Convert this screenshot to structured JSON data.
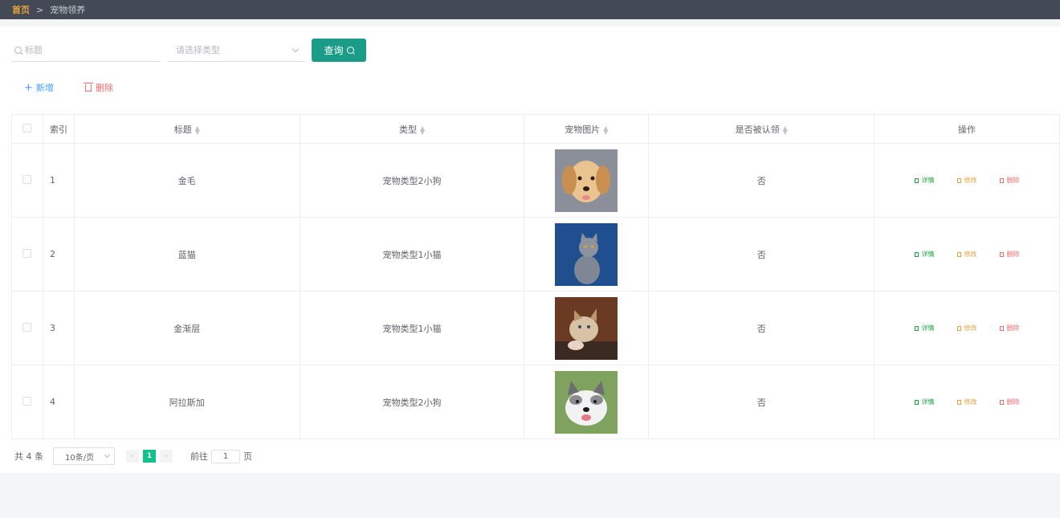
{
  "breadcrumb": {
    "home": "首页",
    "separator": ">",
    "current": "宠物领养"
  },
  "search": {
    "title_placeholder": "标题",
    "type_placeholder": "请选择类型",
    "query_label": "查询"
  },
  "actions": {
    "add_label": "新增",
    "delete_label": "删除"
  },
  "table": {
    "headers": {
      "index": "索引",
      "title": "标题",
      "type": "类型",
      "image": "宠物图片",
      "adopted": "是否被认领",
      "operation": "操作"
    },
    "rows": [
      {
        "index": "1",
        "title": "金毛",
        "type": "宠物类型2小狗",
        "image": "golden-retriever-puppy",
        "adopted": "否"
      },
      {
        "index": "2",
        "title": "蓝猫",
        "type": "宠物类型1小猫",
        "image": "british-blue-cat",
        "adopted": "否"
      },
      {
        "index": "3",
        "title": "金渐层",
        "type": "宠物类型1小猫",
        "image": "golden-kitten",
        "adopted": "否"
      },
      {
        "index": "4",
        "title": "阿拉斯加",
        "type": "宠物类型2小狗",
        "image": "malamute-puppy",
        "adopted": "否"
      }
    ],
    "ops": {
      "detail": "详情",
      "edit": "修改",
      "delete": "删除"
    }
  },
  "pagination": {
    "total_text": "共 4 条",
    "page_size": "10条/页",
    "current_page": "1",
    "goto_prefix": "前往",
    "goto_value": "1",
    "goto_suffix": "页"
  },
  "colors": {
    "topbar": "#434a55",
    "primary": "#1a9c88",
    "add": "#409eff",
    "delete": "#f56c6c",
    "detail": "#19a33c",
    "edit": "#e6a23c"
  }
}
